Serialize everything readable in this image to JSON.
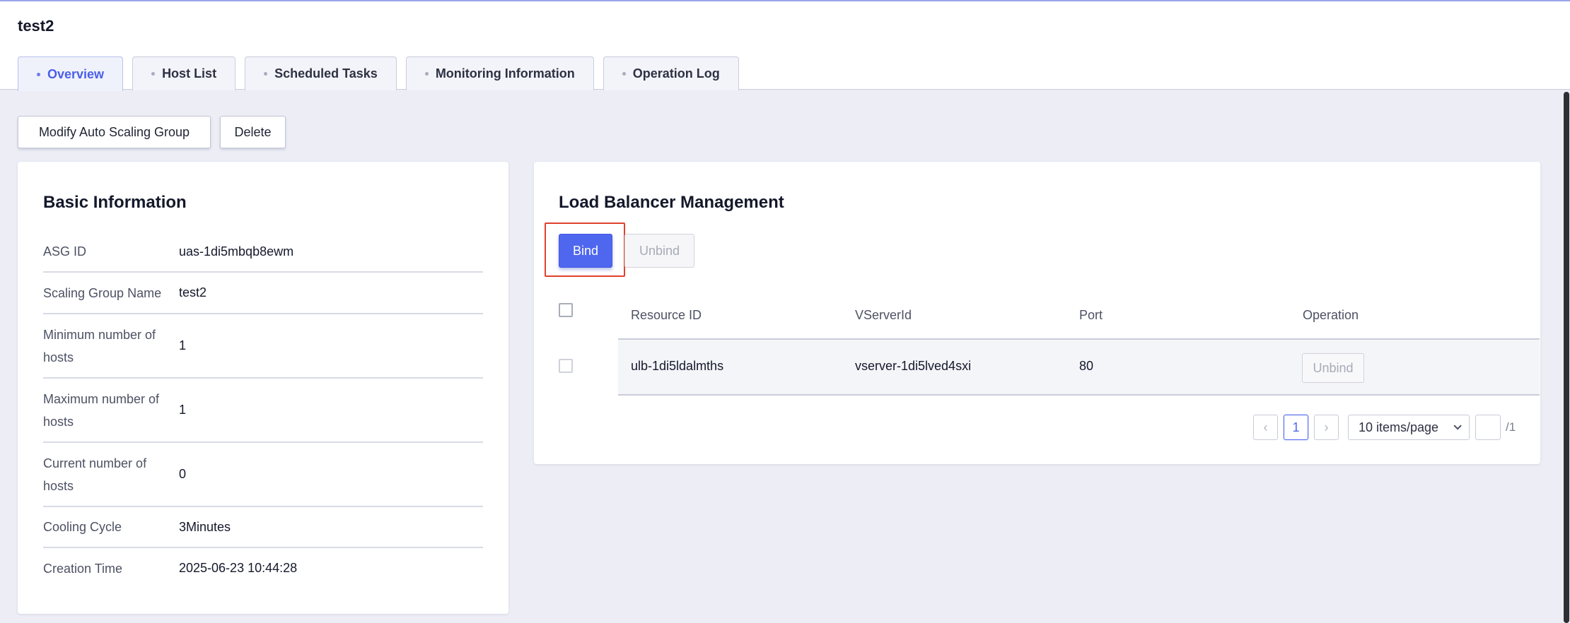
{
  "page": {
    "title": "test2"
  },
  "tabs": [
    {
      "label": "Overview",
      "active": true
    },
    {
      "label": "Host List",
      "active": false
    },
    {
      "label": "Scheduled Tasks",
      "active": false
    },
    {
      "label": "Monitoring Information",
      "active": false
    },
    {
      "label": "Operation Log",
      "active": false
    }
  ],
  "toolbar": {
    "modify_label": "Modify Auto Scaling Group",
    "delete_label": "Delete"
  },
  "basic_info": {
    "title": "Basic Information",
    "rows": [
      {
        "label": "ASG ID",
        "value": "uas-1di5mbqb8ewm"
      },
      {
        "label": "Scaling Group Name",
        "value": "test2"
      },
      {
        "label": "Minimum number of hosts",
        "value": "1"
      },
      {
        "label": "Maximum number of hosts",
        "value": "1"
      },
      {
        "label": "Current number of hosts",
        "value": "0"
      },
      {
        "label": "Cooling Cycle",
        "value": "3Minutes"
      },
      {
        "label": "Creation Time",
        "value": "2025-06-23 10:44:28"
      }
    ]
  },
  "load_balancer": {
    "title": "Load Balancer Management",
    "bind_label": "Bind",
    "unbind_label": "Unbind",
    "columns": [
      "Resource ID",
      "VServerId",
      "Port",
      "Operation"
    ],
    "rows": [
      {
        "resource_id": "ulb-1di5ldalmths",
        "vserver_id": "vserver-1di5lved4sxi",
        "port": "80",
        "operation": "Unbind"
      }
    ],
    "pagination": {
      "prev": "‹",
      "current_page": "1",
      "next": "›",
      "page_size": "10 items/page",
      "page_input": "",
      "total": "/1"
    }
  },
  "colors": {
    "accent": "#4f66ef",
    "highlight": "#e0412d"
  },
  "icons": {
    "tab_dot": "dot-icon",
    "dropdown": "chevron-down-icon",
    "prev": "chevron-left-icon",
    "next": "chevron-right-icon"
  }
}
